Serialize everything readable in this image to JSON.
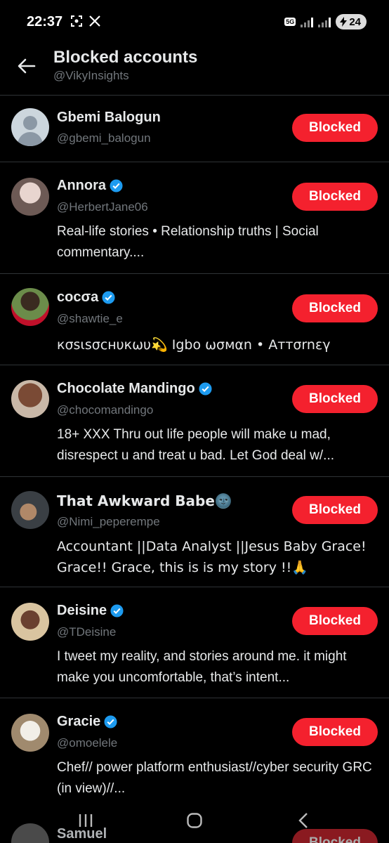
{
  "status_bar": {
    "time": "22:37",
    "left_icons": [
      "screenshot-icon",
      "x-logo-icon"
    ],
    "network_badge": "5G",
    "battery": "24"
  },
  "header": {
    "title": "Blocked accounts",
    "subtitle": "@VikyInsights"
  },
  "accounts": [
    {
      "name": "Gbemi Balogun",
      "handle": "@gbemi_balogun",
      "verified": false,
      "bio": "",
      "button": "Blocked"
    },
    {
      "name": "Annora",
      "handle": "@HerbertJane06",
      "verified": true,
      "bio": "Real-life stories • Relationship truths | Social commentary....",
      "button": "Blocked"
    },
    {
      "name": "cocσa",
      "handle": "@shawtie_e",
      "verified": true,
      "bio": "кσѕιѕσϲнυкωυ💫 Igbo ωσмαn • Aттσrnεγ",
      "button": "Blocked"
    },
    {
      "name": "Chocolate Mandingo",
      "handle": "@chocomandingo",
      "verified": true,
      "bio": "18+ XXX Thru out life people will make u mad, disrespect u and treat u bad. Let God deal w/...",
      "button": "Blocked"
    },
    {
      "name": "That Awkward Babe🌚",
      "handle": "@Nimi_peperempe",
      "verified": false,
      "bio": "Accountant ||Data Analyst ||Jesus Baby Grace! Grace!! Grace, this is is my story !!🙏",
      "button": "Blocked"
    },
    {
      "name": "Deisine",
      "handle": "@TDeisine",
      "verified": true,
      "bio": "I tweet my reality, and stories around me. it might make you uncomfortable, that’s intent...",
      "button": "Blocked"
    },
    {
      "name": "Gracie",
      "handle": "@omoelele",
      "verified": true,
      "bio": "Chef//  power platform enthusiast//cyber security GRC (in view)//...",
      "button": "Blocked"
    },
    {
      "name": "Samuel",
      "handle": "",
      "verified": false,
      "bio": "",
      "button": "Blocked"
    }
  ],
  "colors": {
    "background": "#000000",
    "blocked_button": "#f4212e",
    "verified_badge": "#1d9bf0",
    "secondary_text": "#71767b",
    "divider": "#2f3336"
  },
  "navbar": {
    "icons": [
      "recent-apps-icon",
      "home-icon",
      "back-icon"
    ]
  }
}
